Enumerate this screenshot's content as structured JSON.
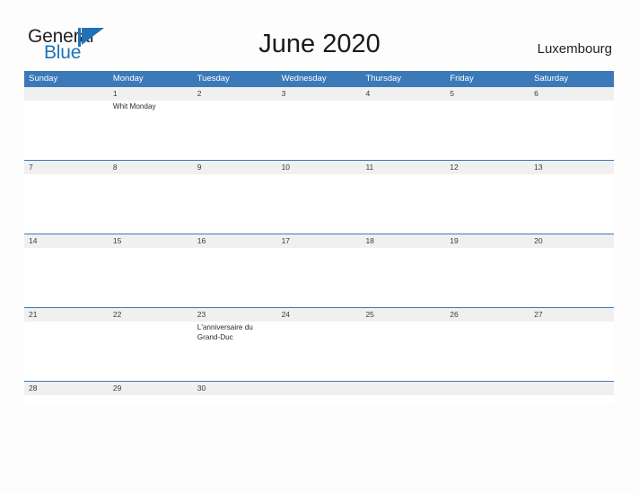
{
  "brand": {
    "name_part1": "General",
    "name_part2": "Blue",
    "logo_icon": "triangle-flag-icon",
    "colors": {
      "accent": "#1f72b8",
      "dark": "#231f20"
    }
  },
  "header": {
    "title": "June 2020",
    "country": "Luxembourg"
  },
  "theme": {
    "header_blue": "#3c79b8",
    "band_gray": "#f0f0f0",
    "page_bg": "#fdfdfd",
    "text_dark": "#2b2b2b"
  },
  "calendar": {
    "month": "June",
    "year": "2020",
    "weekday_headers": [
      "Sunday",
      "Monday",
      "Tuesday",
      "Wednesday",
      "Thursday",
      "Friday",
      "Saturday"
    ],
    "weeks": [
      {
        "days": [
          {
            "num": "",
            "event": ""
          },
          {
            "num": "1",
            "event": "Whit Monday"
          },
          {
            "num": "2",
            "event": ""
          },
          {
            "num": "3",
            "event": ""
          },
          {
            "num": "4",
            "event": ""
          },
          {
            "num": "5",
            "event": ""
          },
          {
            "num": "6",
            "event": ""
          }
        ]
      },
      {
        "days": [
          {
            "num": "7",
            "event": ""
          },
          {
            "num": "8",
            "event": ""
          },
          {
            "num": "9",
            "event": ""
          },
          {
            "num": "10",
            "event": ""
          },
          {
            "num": "11",
            "event": ""
          },
          {
            "num": "12",
            "event": ""
          },
          {
            "num": "13",
            "event": ""
          }
        ]
      },
      {
        "days": [
          {
            "num": "14",
            "event": ""
          },
          {
            "num": "15",
            "event": ""
          },
          {
            "num": "16",
            "event": ""
          },
          {
            "num": "17",
            "event": ""
          },
          {
            "num": "18",
            "event": ""
          },
          {
            "num": "19",
            "event": ""
          },
          {
            "num": "20",
            "event": ""
          }
        ]
      },
      {
        "days": [
          {
            "num": "21",
            "event": ""
          },
          {
            "num": "22",
            "event": ""
          },
          {
            "num": "23",
            "event": "L'anniversaire du Grand-Duc"
          },
          {
            "num": "24",
            "event": ""
          },
          {
            "num": "25",
            "event": ""
          },
          {
            "num": "26",
            "event": ""
          },
          {
            "num": "27",
            "event": ""
          }
        ]
      },
      {
        "days": [
          {
            "num": "28",
            "event": ""
          },
          {
            "num": "29",
            "event": ""
          },
          {
            "num": "30",
            "event": ""
          },
          {
            "num": "",
            "event": ""
          },
          {
            "num": "",
            "event": ""
          },
          {
            "num": "",
            "event": ""
          },
          {
            "num": "",
            "event": ""
          }
        ]
      }
    ]
  }
}
